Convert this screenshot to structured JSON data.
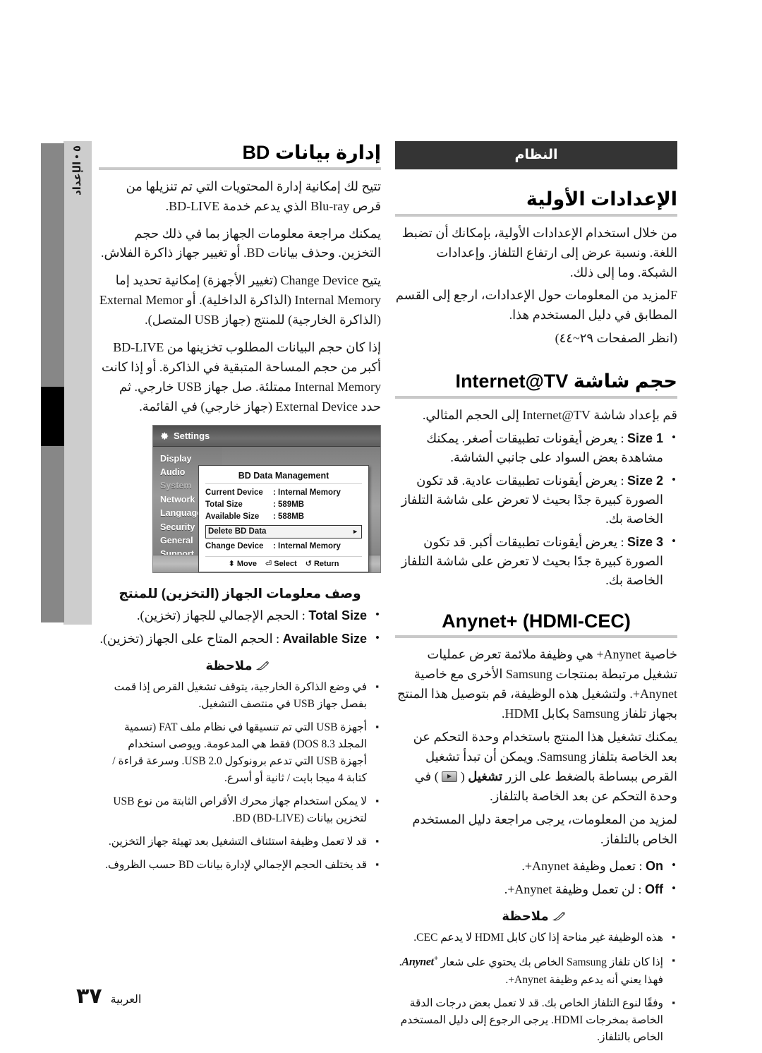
{
  "page": {
    "language_label": "العربية",
    "page_number": "٣٧",
    "chapter_tab": "٥ • الإعداد"
  },
  "left_column": {
    "title": "إدارة بيانات BD",
    "paragraphs": [
      "تتيح لك إمكانية إدارة المحتويات التي تم تنزيلها من قرص Blu-ray الذي يدعم خدمة BD-LIVE.",
      "يمكنك مراجعة معلومات الجهاز بما في ذلك حجم التخزين. وحذف بيانات BD. أو تغيير جهاز ذاكرة الفلاش.",
      "يتيح Change Device (تغيير الأجهزة) إمكانية تحديد إما Internal Memory (الذاكرة الداخلية). أو External Memor (الذاكرة الخارجية) للمنتج (جهاز USB المتصل).",
      "إذا كان حجم البيانات المطلوب تخزينها من BD-LIVE أكبر من حجم المساحة المتبقية في الذاكرة. أو إذا كانت Internal Memory ممتلئة. صل جهاز USB خارجي. ثم حدد External Device (جهاز خارجي) في القائمة."
    ],
    "screenshot": {
      "window_title": "Settings",
      "menu_items": [
        "Display",
        "Audio",
        "System",
        "Network",
        "Language",
        "Security",
        "General",
        "Support"
      ],
      "menu_selected": "System",
      "dialog_title": "BD Data Management",
      "dialog_rows": [
        {
          "key": "Current Device",
          "value": ": Internal Memory"
        },
        {
          "key": "Total Size",
          "value": ": 589MB"
        },
        {
          "key": "Available Size",
          "value": ": 588MB"
        }
      ],
      "dialog_selected_row": "Delete BD Data",
      "dialog_selected_arrow": "►",
      "dialog_row_after": {
        "key": "Change Device",
        "value": ": Internal Memory"
      },
      "footer_hints": [
        "Move",
        "Select",
        "Return"
      ],
      "footer_icons": [
        "⬍",
        "⏎",
        "↺"
      ]
    },
    "device_info_heading": "وصف معلومات الجهاز (التخزين) للمنتج",
    "device_info_bullets": [
      "Total Size : الحجم الإجمالي للجهاز (تخزين).",
      "Available Size : الحجم المتاح على الجهاز (تخزين)."
    ],
    "note_label": "ملاحظة",
    "notes": [
      "في وضع الذاكرة الخارجية، يتوقف تشغيل القرص إذا قمت بفصل جهاز USB في منتصف التشغيل.",
      "أجهزة USB التي تم تنسيقها في نظام ملف FAT (تسمية المجلد DOS 8.3) فقط هي المدعومة. ويوصى استخدام أجهزة USB التي تدعم برونوكول USB 2.0. وسرعة قراءة / كتابة 4 ميجا بايت / ثانية أو أسرع.",
      "لا يمكن استخدام جهاز محرك الأقراص الثابتة من نوع USB لتخزين بيانات BD (BD-LIVE).",
      "قد لا تعمل وظيفة استئناف التشغيل بعد تهيئة جهاز التخزين.",
      "قد يختلف الحجم الإجمالي لإدارة بيانات BD حسب الظروف."
    ]
  },
  "right_column": {
    "banner": "النظام",
    "initial_settings": {
      "title": "الإعدادات الأولية",
      "paragraphs": [
        "من خلال استخدام الإعدادات الأولية، بإمكانك أن تضبط اللغة. ونسبة عرض إلى ارتفاع التلفاز. وإعدادات الشبكة. وما إلى ذلك.",
        "Fلمزيد من المعلومات حول الإعدادات، ارجع إلى القسم المطابق في دليل المستخدم هذا.",
        "(انظر الصفحات ٢٩~٤٤)"
      ]
    },
    "screen_size": {
      "title": "حجم شاشة Internet@TV",
      "intro": "قم بإعداد شاشة Internet@TV إلى الحجم المثالي.",
      "bullets": [
        "Size 1 : يعرض أيقونات تطبيقات أصغر. يمكنك مشاهدة بعض السواد على جانبي الشاشة.",
        "Size 2 : يعرض أيقونات تطبيقات عادية. قد تكون الصورة كبيرة جدًا بحيث لا تعرض على شاشة التلفاز الخاصة بك.",
        "Size 3 : يعرض أيقونات تطبيقات أكبر. قد تكون الصورة كبيرة جدًا بحيث لا تعرض على شاشة التلفاز الخاصة بك."
      ]
    },
    "anynet": {
      "title": "Anynet+ (HDMI-CEC)",
      "paragraphs": [
        "خاصية Anynet+ هي وظيفة ملائمة تعرض عمليات تشغيل مرتبطة بمنتجات Samsung الأخرى مع خاصية Anynet+. ولتشغيل هذه الوظيفة، قم بتوصيل هذا المنتج بجهاز تلفاز Samsung بكابل HDMI.",
        "يمكنك تشغيل هذا المنتج باستخدام وحدة التحكم عن بعد الخاصة بتلفاز Samsung. ويمكن أن تبدأ تشغيل القرص ببساطة بالضغط على الزر تشغيل (  ) في وحدة التحكم عن بعد الخاصة بالتلفاز.",
        "لمزيد من المعلومات، يرجى مراجعة دليل المستخدم الخاص بالتلفاز."
      ],
      "play_button_label": "تشغيل",
      "bullets": [
        "On : تعمل وظيفة Anynet+.",
        "Off : لن تعمل وظيفة Anynet+."
      ],
      "note_label": "ملاحظة",
      "notes": [
        "هذه الوظيفة غير مناحة إذا كان كابل HDMI لا يدعم CEC.",
        "إذا كان تلفاز Samsung الخاص بك يحتوي على شعار Anynet+. فهذا يعني أنه يدعم وظيفة Anynet+.",
        "وفقًا لنوع التلفاز الخاص بك. قد لا تعمل بعض درجات الدقة الخاصة بمخرجات HDMI. يرجى الرجوع إلى دليل المستخدم الخاص بالتلفاز."
      ],
      "logo_text": "Anynet",
      "logo_sup": "+"
    }
  },
  "colors": {
    "banner_bg": "#343434",
    "rule": "#c9c9c9",
    "tab_dark": "#878787",
    "tab_light": "#cdcdcd",
    "tab_marker": "#000000"
  }
}
